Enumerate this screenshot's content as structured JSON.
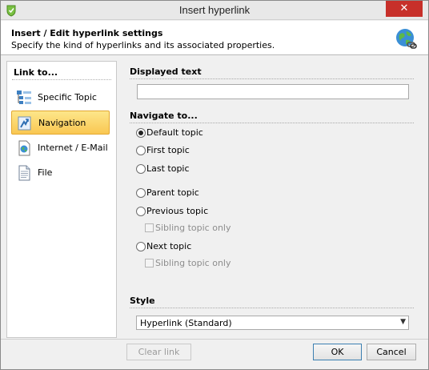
{
  "window": {
    "title": "Insert hyperlink",
    "close_glyph": "✕"
  },
  "header": {
    "title": "Insert / Edit hyperlink settings",
    "subtitle": "Specify the kind of hyperlinks and its associated properties.",
    "icon": "globe-link-icon"
  },
  "link_to": {
    "heading": "Link to...",
    "items": [
      {
        "label": "Specific Topic",
        "icon": "topic-tree-icon",
        "selected": false
      },
      {
        "label": "Navigation",
        "icon": "navigation-icon",
        "selected": true
      },
      {
        "label": "Internet / E-Mail",
        "icon": "internet-icon",
        "selected": false
      },
      {
        "label": "File",
        "icon": "file-icon",
        "selected": false
      }
    ]
  },
  "displayed_text": {
    "heading": "Displayed text",
    "value": ""
  },
  "navigate_to": {
    "heading": "Navigate to...",
    "options": [
      {
        "label": "Default topic",
        "checked": true
      },
      {
        "label": "First topic",
        "checked": false
      },
      {
        "label": "Last topic",
        "checked": false
      },
      {
        "label": "Parent topic",
        "checked": false
      },
      {
        "label": "Previous topic",
        "checked": false
      },
      {
        "label": "Next topic",
        "checked": false
      }
    ],
    "sibling_previous": "Sibling topic only",
    "sibling_next": "Sibling topic only"
  },
  "style": {
    "heading": "Style",
    "selected": "Hyperlink (Standard)"
  },
  "footer": {
    "clear_label": "Clear link",
    "ok_label": "OK",
    "cancel_label": "Cancel"
  },
  "colors": {
    "close_button": "#c7302a",
    "selected_item": "#f9c752",
    "selected_border": "#e3a831"
  }
}
